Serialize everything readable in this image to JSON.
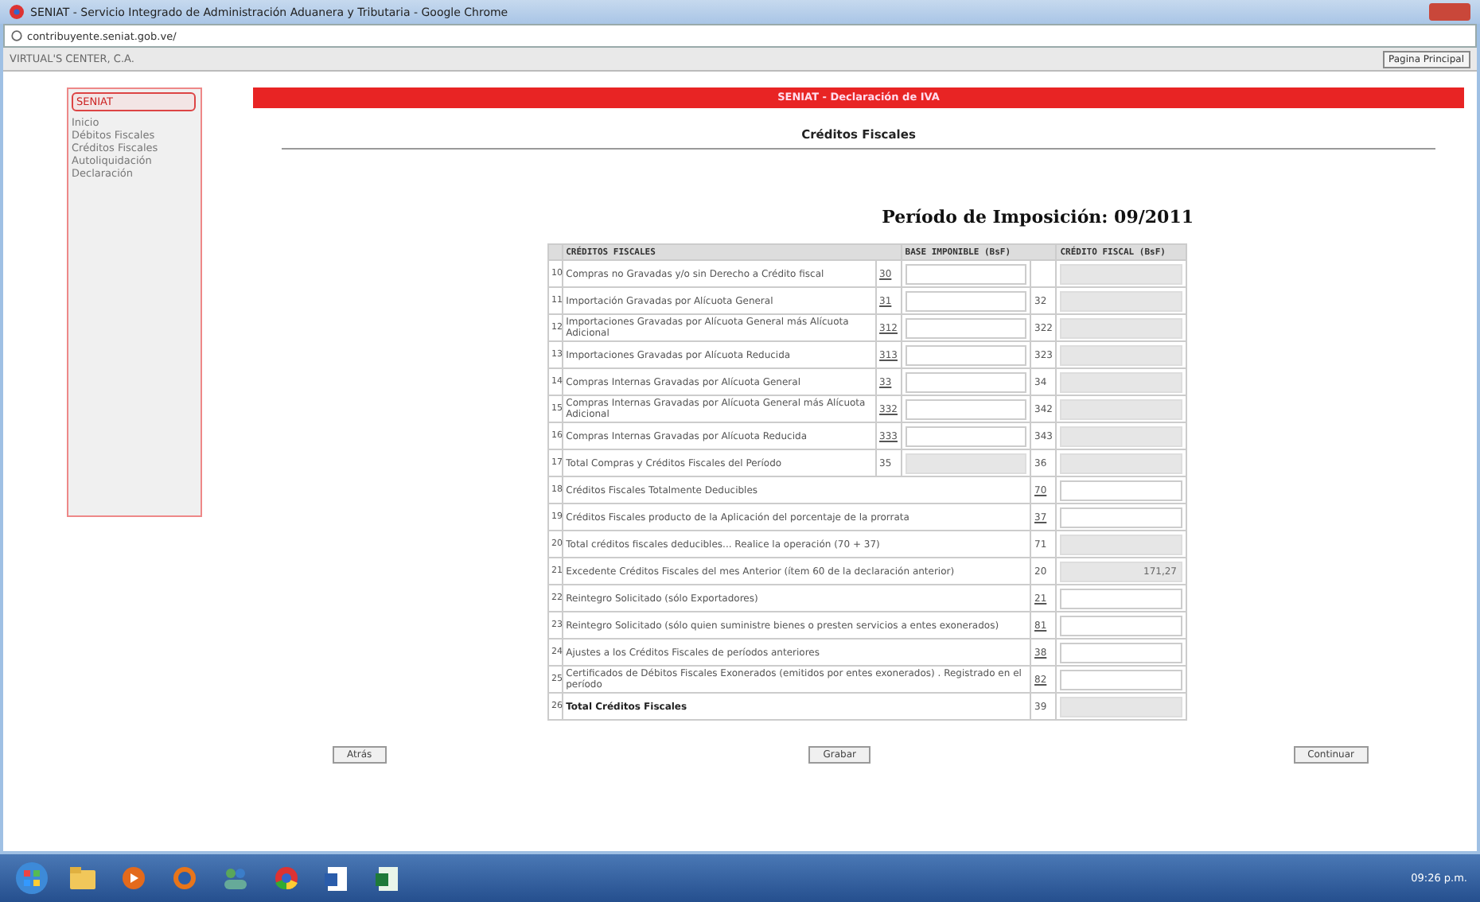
{
  "window": {
    "title": "SENIAT - Servicio Integrado de Administración Aduanera y Tributaria - Google Chrome",
    "address": "contribuyente.seniat.gob.ve/"
  },
  "header": {
    "company": "VIRTUAL'S CENTER, C.A.",
    "home_button": "Pagina Principal"
  },
  "sidebar": {
    "title": "SENIAT",
    "items": [
      "Inicio",
      "Débitos Fiscales",
      "Créditos Fiscales",
      "Autoliquidación",
      "Declaración"
    ]
  },
  "banner": "SENIAT - Declaración de IVA",
  "section_title": "Créditos Fiscales",
  "period": "Período de Imposición: 09/2011",
  "table": {
    "columns": [
      "CRÉDITOS FISCALES",
      "BASE IMPONIBLE (BsF)",
      "CRÉDITO FISCAL (BsF)"
    ],
    "rows": [
      {
        "kind": "pair",
        "num": "10",
        "label": "Compras no Gravadas y/o sin Derecho a Crédito fiscal",
        "code": "30",
        "code_link": true,
        "base_disabled": false
      },
      {
        "kind": "pair",
        "num": "11",
        "label": "Importación Gravadas por Alícuota General",
        "code": "31",
        "code_link": true,
        "base_disabled": false,
        "credit_code": "32"
      },
      {
        "kind": "pair",
        "num": "12",
        "label": "Importaciones Gravadas por Alícuota General más Alícuota Adicional",
        "code": "312",
        "code_link": true,
        "base_disabled": false,
        "credit_code": "322"
      },
      {
        "kind": "pair",
        "num": "13",
        "label": "Importaciones Gravadas por Alícuota Reducida",
        "code": "313",
        "code_link": true,
        "base_disabled": false,
        "credit_code": "323"
      },
      {
        "kind": "pair",
        "num": "14",
        "label": "Compras Internas Gravadas por Alícuota General",
        "code": "33",
        "code_link": true,
        "base_disabled": false,
        "credit_code": "34"
      },
      {
        "kind": "pair",
        "num": "15",
        "label": "Compras Internas Gravadas por Alícuota General más Alícuota Adicional",
        "code": "332",
        "code_link": true,
        "base_disabled": false,
        "credit_code": "342"
      },
      {
        "kind": "pair",
        "num": "16",
        "label": "Compras Internas Gravadas por Alícuota Reducida",
        "code": "333",
        "code_link": true,
        "base_disabled": false,
        "credit_code": "343"
      },
      {
        "kind": "pair",
        "num": "17",
        "label": "Total Compras y Créditos Fiscales del Período",
        "code": "35",
        "code_link": false,
        "base_disabled": true,
        "credit_code": "36"
      },
      {
        "kind": "single",
        "num": "18",
        "label": "Créditos Fiscales Totalmente Deducibles",
        "code": "70",
        "code_link": true,
        "disabled": false,
        "bold": false
      },
      {
        "kind": "single",
        "num": "19",
        "label": "Créditos Fiscales producto de la Aplicación del porcentaje de la prorrata",
        "code": "37",
        "code_link": true,
        "disabled": false,
        "bold": false
      },
      {
        "kind": "single",
        "num": "20",
        "label": "Total créditos fiscales deducibles... Realice la operación (70 + 37)",
        "code": "71",
        "code_link": false,
        "disabled": true,
        "bold": false
      },
      {
        "kind": "single",
        "num": "21",
        "label": "Excedente Créditos Fiscales del mes Anterior (ítem 60 de la declaración anterior)",
        "code": "20",
        "code_link": false,
        "disabled": true,
        "bold": false,
        "value": "171,27"
      },
      {
        "kind": "single",
        "num": "22",
        "label": "Reintegro Solicitado (sólo Exportadores)",
        "code": "21",
        "code_link": true,
        "disabled": false,
        "bold": false
      },
      {
        "kind": "single",
        "num": "23",
        "label": "Reintegro Solicitado (sólo quien suministre bienes o presten servicios a entes exonerados)",
        "code": "81",
        "code_link": true,
        "disabled": false,
        "bold": false
      },
      {
        "kind": "single",
        "num": "24",
        "label": "Ajustes a los Créditos Fiscales de períodos anteriores",
        "code": "38",
        "code_link": true,
        "disabled": false,
        "bold": false
      },
      {
        "kind": "single",
        "num": "25",
        "label": "Certificados de Débitos Fiscales Exonerados (emitidos por entes exonerados) . Registrado en el período",
        "code": "82",
        "code_link": true,
        "disabled": false,
        "bold": false
      },
      {
        "kind": "single",
        "num": "26",
        "label": "Total Créditos Fiscales",
        "code": "39",
        "code_link": false,
        "disabled": true,
        "bold": true
      }
    ]
  },
  "buttons": [
    "Atrás",
    "Grabar",
    "Continuar"
  ],
  "taskbar": {
    "time": "09:26 p.m."
  }
}
